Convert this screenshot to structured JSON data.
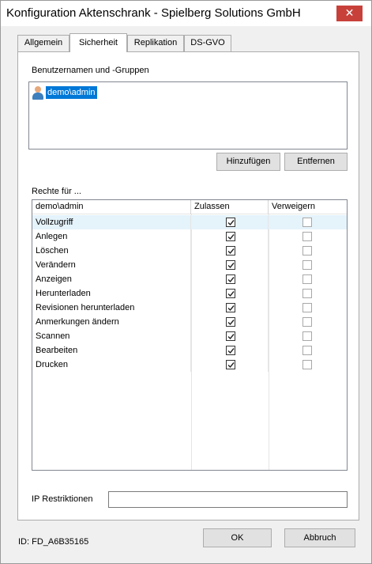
{
  "window": {
    "title": "Konfiguration Aktenschrank  - Spielberg Solutions GmbH",
    "close_glyph": "✕"
  },
  "tabs": [
    {
      "label": "Allgemein",
      "active": false
    },
    {
      "label": "Sicherheit",
      "active": true
    },
    {
      "label": "Replikation",
      "active": false
    },
    {
      "label": "DS-GVO",
      "active": false
    }
  ],
  "security": {
    "users_label": "Benutzernamen und -Gruppen",
    "users": [
      {
        "name": "demo\\admin",
        "selected": true,
        "icon": "user-icon"
      }
    ],
    "add_button": "Hinzufügen",
    "remove_button": "Entfernen",
    "rights_label": "Rechte für ...",
    "grid": {
      "headers": [
        "demo\\admin",
        "Zulassen",
        "Verweigern"
      ],
      "rows": [
        {
          "name": "Vollzugriff",
          "allow": true,
          "deny": false,
          "selected": true
        },
        {
          "name": "Anlegen",
          "allow": true,
          "deny": false
        },
        {
          "name": "Löschen",
          "allow": true,
          "deny": false
        },
        {
          "name": "Verändern",
          "allow": true,
          "deny": false
        },
        {
          "name": "Anzeigen",
          "allow": true,
          "deny": false
        },
        {
          "name": "Herunterladen",
          "allow": true,
          "deny": false
        },
        {
          "name": "Revisionen herunterladen",
          "allow": true,
          "deny": false
        },
        {
          "name": "Anmerkungen ändern",
          "allow": true,
          "deny": false
        },
        {
          "name": "Scannen",
          "allow": true,
          "deny": false
        },
        {
          "name": "Bearbeiten",
          "allow": true,
          "deny": false
        },
        {
          "name": "Drucken",
          "allow": true,
          "deny": false
        }
      ]
    },
    "ip_label": "IP Restriktionen",
    "ip_value": ""
  },
  "footer": {
    "id_text": "ID: FD_A6B35165",
    "ok_button": "OK",
    "cancel_button": "Abbruch"
  },
  "colors": {
    "close_button": "#c7413a",
    "selection": "#0078d7",
    "row_highlight": "#e5f3fb"
  }
}
